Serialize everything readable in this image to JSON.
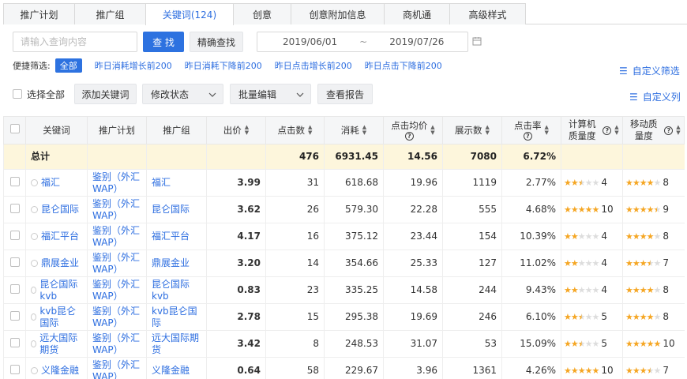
{
  "tabs": [
    "推广计划",
    "推广组",
    "关键词(124)",
    "创意",
    "创意附加信息",
    "商机通",
    "高级样式"
  ],
  "active_tab": 2,
  "search": {
    "placeholder": "请输入查询内容",
    "button": "查 找",
    "exact_button": "精确查找"
  },
  "date": {
    "start": "2019/06/01",
    "sep": "~",
    "end": "2019/07/26"
  },
  "filter": {
    "label": "便捷筛选:",
    "chips": [
      "全部",
      "昨日消耗增长前200",
      "昨日消耗下降前200",
      "昨日点击增长前200",
      "昨日点击下降前200"
    ]
  },
  "custom_filter": "自定义筛选",
  "custom_columns": "自定义列",
  "toolbar": {
    "select_all": "选择全部",
    "add_keyword": "添加关键词",
    "modify_status": "修改状态",
    "batch_edit": "批量编辑",
    "view_report": "查看报告"
  },
  "columns": [
    "关键词",
    "推广计划",
    "推广组",
    "出价",
    "点击数",
    "消耗",
    "点击均价",
    "展示数",
    "点击率",
    "计算机质量度",
    "移动质量度"
  ],
  "total": {
    "label": "总计",
    "clicks": "476",
    "cost": "6931.45",
    "avg_cpc": "14.56",
    "impressions": "7080",
    "ctr": "6.72%"
  },
  "rows": [
    {
      "keyword": "福汇",
      "plan": "鉴别（外汇WAP）",
      "group": "福汇",
      "bid": "3.99",
      "clicks": "31",
      "cost": "618.68",
      "avg_cpc": "19.96",
      "impressions": "1119",
      "ctr": "2.77%",
      "pc_stars": 2.5,
      "pc_score": "4",
      "m_stars": 4,
      "m_score": "8"
    },
    {
      "keyword": "昆仑国际",
      "plan": "鉴别（外汇WAP）",
      "group": "昆仑国际",
      "bid": "3.62",
      "clicks": "26",
      "cost": "579.30",
      "avg_cpc": "22.28",
      "impressions": "555",
      "ctr": "4.68%",
      "pc_stars": 5,
      "pc_score": "10",
      "m_stars": 4.5,
      "m_score": "9"
    },
    {
      "keyword": "福汇平台",
      "plan": "鉴别（外汇WAP）",
      "group": "福汇平台",
      "bid": "4.17",
      "clicks": "16",
      "cost": "375.12",
      "avg_cpc": "23.44",
      "impressions": "154",
      "ctr": "10.39%",
      "pc_stars": 2,
      "pc_score": "4",
      "m_stars": 4,
      "m_score": "8"
    },
    {
      "keyword": "鼎展金业",
      "plan": "鉴别（外汇WAP）",
      "group": "鼎展金业",
      "bid": "3.20",
      "clicks": "14",
      "cost": "354.66",
      "avg_cpc": "25.33",
      "impressions": "127",
      "ctr": "11.02%",
      "pc_stars": 2,
      "pc_score": "4",
      "m_stars": 3.5,
      "m_score": "7"
    },
    {
      "keyword": "昆仑国际kvb",
      "plan": "鉴别（外汇WAP）",
      "group": "昆仑国际kvb",
      "bid": "0.83",
      "clicks": "23",
      "cost": "335.25",
      "avg_cpc": "14.58",
      "impressions": "244",
      "ctr": "9.43%",
      "pc_stars": 2,
      "pc_score": "4",
      "m_stars": 4,
      "m_score": "8"
    },
    {
      "keyword": "kvb昆仑国际",
      "plan": "鉴别（外汇WAP）",
      "group": "kvb昆仑国际",
      "bid": "2.78",
      "clicks": "15",
      "cost": "295.38",
      "avg_cpc": "19.69",
      "impressions": "246",
      "ctr": "6.10%",
      "pc_stars": 2.5,
      "pc_score": "5",
      "m_stars": 4,
      "m_score": "8"
    },
    {
      "keyword": "远大国际期货",
      "plan": "鉴别（外汇WAP）",
      "group": "远大国际期货",
      "bid": "3.42",
      "clicks": "8",
      "cost": "248.53",
      "avg_cpc": "31.07",
      "impressions": "53",
      "ctr": "15.09%",
      "pc_stars": 2.5,
      "pc_score": "5",
      "m_stars": 5,
      "m_score": "10"
    },
    {
      "keyword": "义隆金融",
      "plan": "鉴别（外汇WAP）",
      "group": "义隆金融",
      "bid": "0.64",
      "clicks": "58",
      "cost": "229.67",
      "avg_cpc": "3.96",
      "impressions": "1361",
      "ctr": "4.26%",
      "pc_stars": 5,
      "pc_score": "10",
      "m_stars": 3.5,
      "m_score": "7"
    }
  ],
  "colors": {
    "accent": "#2d72e0",
    "link": "#2d6ee0",
    "star": "#f5a623",
    "total_bg": "#fdf6dc"
  }
}
